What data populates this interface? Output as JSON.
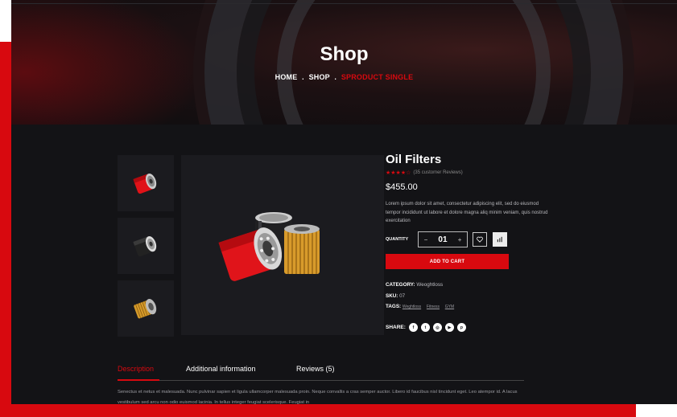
{
  "hero": {
    "title": "Shop",
    "breadcrumb": {
      "home": "HOME",
      "sep1": ".",
      "shop": "SHOP",
      "sep2": ".",
      "current": "SPRODUCT SINGLE"
    }
  },
  "product": {
    "title": "Oil Filters",
    "rating": 3.5,
    "reviews_text": "(35 customer Reviews)",
    "price": "$455.00",
    "description": "Lorem ipsum dolor sit amet, consectetur adipiscing elit, sed do eiusmod tempor incididunt ut labore et dolore magna aliq minim veniam, quis nostrud exercitation",
    "quantity_label": "QUANTITY",
    "quantity_value": "01",
    "minus": "−",
    "plus": "+",
    "add_to_cart": "ADD TO CART",
    "category_label": "CATEGORY:",
    "category_value": "Weoghtloss",
    "sku_label": "SKU:",
    "sku_value": "07",
    "tags_label": "TAGS:",
    "tags": [
      "Weghtloss",
      "Fitness",
      "GYM"
    ],
    "share_label": "SHARE:",
    "share_icons": [
      {
        "name": "facebook-icon",
        "glyph": "f"
      },
      {
        "name": "twitter-icon",
        "glyph": "t"
      },
      {
        "name": "instagram-icon",
        "glyph": "◎"
      },
      {
        "name": "youtube-icon",
        "glyph": "▶"
      },
      {
        "name": "pinterest-icon",
        "glyph": "p"
      }
    ]
  },
  "tabs": {
    "items": [
      "Description",
      "Additional information",
      "Reviews (5)"
    ],
    "active": 0,
    "content": "Senectus et netus et malesuada. Nunc pulvinar sapien et ligula ullamcorper malesuada proin. Neque convallis a cras semper auctor. Libero id faucibus nisl tincidunt eget. Leo atempor id. A lacus vestibulum sed arcu non odio euismod lacinia. In tellus integer feugiat scelerisque. Feugiat in"
  },
  "colors": {
    "accent": "#d8090f",
    "background": "#131316",
    "card": "#1b1b1f"
  }
}
